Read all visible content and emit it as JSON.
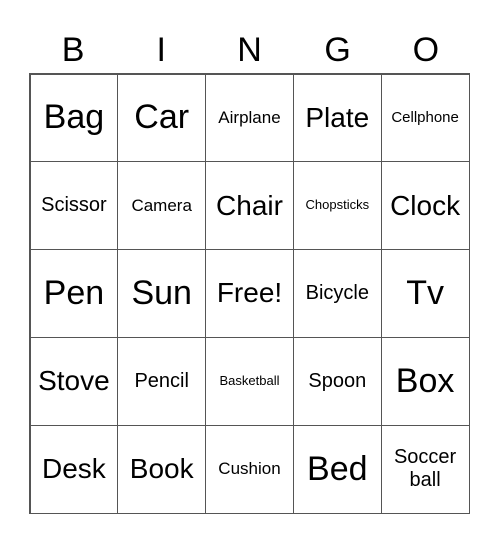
{
  "header": [
    "B",
    "I",
    "N",
    "G",
    "O"
  ],
  "cells": [
    [
      "Bag",
      "Car",
      "Airplane",
      "Plate",
      "Cellphone"
    ],
    [
      "Scissor",
      "Camera",
      "Chair",
      "Chopsticks",
      "Clock"
    ],
    [
      "Pen",
      "Sun",
      "Free!",
      "Bicycle",
      "Tv"
    ],
    [
      "Stove",
      "Pencil",
      "Basketball",
      "Spoon",
      "Box"
    ],
    [
      "Desk",
      "Book",
      "Cushion",
      "Bed",
      "Soccer ball"
    ]
  ]
}
